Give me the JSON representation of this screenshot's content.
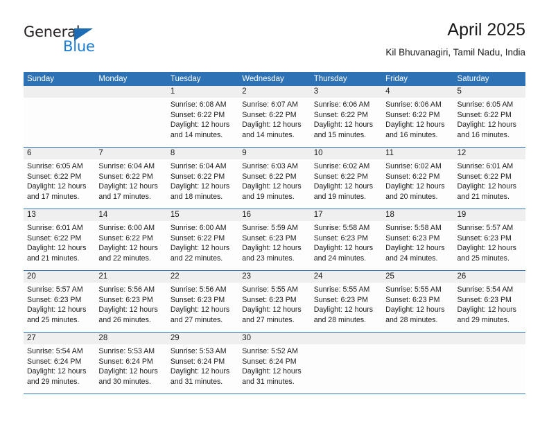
{
  "brand": {
    "name_part1": "General",
    "name_part2": "Blue",
    "accent_color": "#1b7ad1",
    "header_color": "#2d72b5"
  },
  "header": {
    "title": "April 2025",
    "subtitle": "Kil Bhuvanagiri, Tamil Nadu, India"
  },
  "calendar": {
    "weekdays": [
      "Sunday",
      "Monday",
      "Tuesday",
      "Wednesday",
      "Thursday",
      "Friday",
      "Saturday"
    ],
    "weeks": [
      [
        {
          "day": "",
          "lines": []
        },
        {
          "day": "",
          "lines": []
        },
        {
          "day": "1",
          "lines": [
            "Sunrise: 6:08 AM",
            "Sunset: 6:22 PM",
            "Daylight: 12 hours",
            "and 14 minutes."
          ]
        },
        {
          "day": "2",
          "lines": [
            "Sunrise: 6:07 AM",
            "Sunset: 6:22 PM",
            "Daylight: 12 hours",
            "and 14 minutes."
          ]
        },
        {
          "day": "3",
          "lines": [
            "Sunrise: 6:06 AM",
            "Sunset: 6:22 PM",
            "Daylight: 12 hours",
            "and 15 minutes."
          ]
        },
        {
          "day": "4",
          "lines": [
            "Sunrise: 6:06 AM",
            "Sunset: 6:22 PM",
            "Daylight: 12 hours",
            "and 16 minutes."
          ]
        },
        {
          "day": "5",
          "lines": [
            "Sunrise: 6:05 AM",
            "Sunset: 6:22 PM",
            "Daylight: 12 hours",
            "and 16 minutes."
          ]
        }
      ],
      [
        {
          "day": "6",
          "lines": [
            "Sunrise: 6:05 AM",
            "Sunset: 6:22 PM",
            "Daylight: 12 hours",
            "and 17 minutes."
          ]
        },
        {
          "day": "7",
          "lines": [
            "Sunrise: 6:04 AM",
            "Sunset: 6:22 PM",
            "Daylight: 12 hours",
            "and 17 minutes."
          ]
        },
        {
          "day": "8",
          "lines": [
            "Sunrise: 6:04 AM",
            "Sunset: 6:22 PM",
            "Daylight: 12 hours",
            "and 18 minutes."
          ]
        },
        {
          "day": "9",
          "lines": [
            "Sunrise: 6:03 AM",
            "Sunset: 6:22 PM",
            "Daylight: 12 hours",
            "and 19 minutes."
          ]
        },
        {
          "day": "10",
          "lines": [
            "Sunrise: 6:02 AM",
            "Sunset: 6:22 PM",
            "Daylight: 12 hours",
            "and 19 minutes."
          ]
        },
        {
          "day": "11",
          "lines": [
            "Sunrise: 6:02 AM",
            "Sunset: 6:22 PM",
            "Daylight: 12 hours",
            "and 20 minutes."
          ]
        },
        {
          "day": "12",
          "lines": [
            "Sunrise: 6:01 AM",
            "Sunset: 6:22 PM",
            "Daylight: 12 hours",
            "and 21 minutes."
          ]
        }
      ],
      [
        {
          "day": "13",
          "lines": [
            "Sunrise: 6:01 AM",
            "Sunset: 6:22 PM",
            "Daylight: 12 hours",
            "and 21 minutes."
          ]
        },
        {
          "day": "14",
          "lines": [
            "Sunrise: 6:00 AM",
            "Sunset: 6:22 PM",
            "Daylight: 12 hours",
            "and 22 minutes."
          ]
        },
        {
          "day": "15",
          "lines": [
            "Sunrise: 6:00 AM",
            "Sunset: 6:22 PM",
            "Daylight: 12 hours",
            "and 22 minutes."
          ]
        },
        {
          "day": "16",
          "lines": [
            "Sunrise: 5:59 AM",
            "Sunset: 6:23 PM",
            "Daylight: 12 hours",
            "and 23 minutes."
          ]
        },
        {
          "day": "17",
          "lines": [
            "Sunrise: 5:58 AM",
            "Sunset: 6:23 PM",
            "Daylight: 12 hours",
            "and 24 minutes."
          ]
        },
        {
          "day": "18",
          "lines": [
            "Sunrise: 5:58 AM",
            "Sunset: 6:23 PM",
            "Daylight: 12 hours",
            "and 24 minutes."
          ]
        },
        {
          "day": "19",
          "lines": [
            "Sunrise: 5:57 AM",
            "Sunset: 6:23 PM",
            "Daylight: 12 hours",
            "and 25 minutes."
          ]
        }
      ],
      [
        {
          "day": "20",
          "lines": [
            "Sunrise: 5:57 AM",
            "Sunset: 6:23 PM",
            "Daylight: 12 hours",
            "and 25 minutes."
          ]
        },
        {
          "day": "21",
          "lines": [
            "Sunrise: 5:56 AM",
            "Sunset: 6:23 PM",
            "Daylight: 12 hours",
            "and 26 minutes."
          ]
        },
        {
          "day": "22",
          "lines": [
            "Sunrise: 5:56 AM",
            "Sunset: 6:23 PM",
            "Daylight: 12 hours",
            "and 27 minutes."
          ]
        },
        {
          "day": "23",
          "lines": [
            "Sunrise: 5:55 AM",
            "Sunset: 6:23 PM",
            "Daylight: 12 hours",
            "and 27 minutes."
          ]
        },
        {
          "day": "24",
          "lines": [
            "Sunrise: 5:55 AM",
            "Sunset: 6:23 PM",
            "Daylight: 12 hours",
            "and 28 minutes."
          ]
        },
        {
          "day": "25",
          "lines": [
            "Sunrise: 5:55 AM",
            "Sunset: 6:23 PM",
            "Daylight: 12 hours",
            "and 28 minutes."
          ]
        },
        {
          "day": "26",
          "lines": [
            "Sunrise: 5:54 AM",
            "Sunset: 6:23 PM",
            "Daylight: 12 hours",
            "and 29 minutes."
          ]
        }
      ],
      [
        {
          "day": "27",
          "lines": [
            "Sunrise: 5:54 AM",
            "Sunset: 6:24 PM",
            "Daylight: 12 hours",
            "and 29 minutes."
          ]
        },
        {
          "day": "28",
          "lines": [
            "Sunrise: 5:53 AM",
            "Sunset: 6:24 PM",
            "Daylight: 12 hours",
            "and 30 minutes."
          ]
        },
        {
          "day": "29",
          "lines": [
            "Sunrise: 5:53 AM",
            "Sunset: 6:24 PM",
            "Daylight: 12 hours",
            "and 31 minutes."
          ]
        },
        {
          "day": "30",
          "lines": [
            "Sunrise: 5:52 AM",
            "Sunset: 6:24 PM",
            "Daylight: 12 hours",
            "and 31 minutes."
          ]
        },
        {
          "day": "",
          "lines": []
        },
        {
          "day": "",
          "lines": []
        },
        {
          "day": "",
          "lines": []
        }
      ]
    ]
  }
}
